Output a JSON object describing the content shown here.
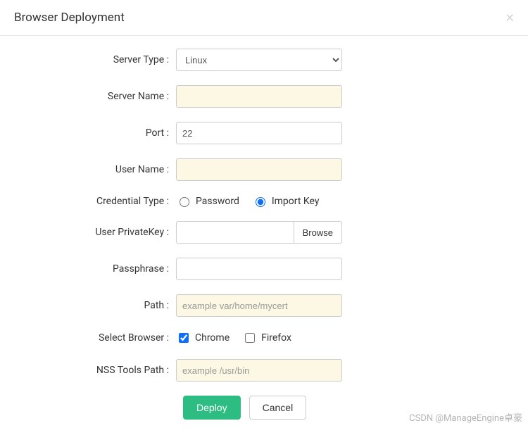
{
  "header": {
    "title": "Browser Deployment"
  },
  "form": {
    "serverType": {
      "label": "Server Type :",
      "value": "Linux"
    },
    "serverName": {
      "label": "Server Name :",
      "value": ""
    },
    "port": {
      "label": "Port :",
      "value": "22"
    },
    "userName": {
      "label": "User Name :",
      "value": ""
    },
    "credentialType": {
      "label": "Credential Type :",
      "options": {
        "password": "Password",
        "importKey": "Import Key"
      },
      "selected": "importKey"
    },
    "userPrivateKey": {
      "label": "User PrivateKey :",
      "value": "",
      "browse": "Browse"
    },
    "passphrase": {
      "label": "Passphrase :",
      "value": ""
    },
    "path": {
      "label": "Path :",
      "placeholder": "example var/home/mycert",
      "value": ""
    },
    "selectBrowser": {
      "label": "Select Browser :",
      "options": {
        "chrome": "Chrome",
        "firefox": "Firefox"
      },
      "chromeChecked": true,
      "firefoxChecked": false
    },
    "nssToolsPath": {
      "label": "NSS Tools Path :",
      "placeholder": "example /usr/bin",
      "value": ""
    }
  },
  "buttons": {
    "deploy": "Deploy",
    "cancel": "Cancel"
  },
  "watermark": "CSDN @ManageEngine卓豪"
}
